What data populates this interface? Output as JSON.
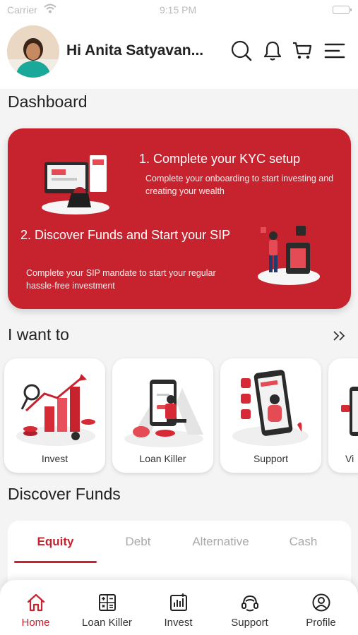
{
  "status_bar": {
    "carrier": "Carrier",
    "time": "9:15 PM"
  },
  "header": {
    "greeting": "Hi Anita Satyavan...",
    "icons": [
      "search-icon",
      "bell-icon",
      "cart-icon",
      "menu-icon"
    ]
  },
  "dashboard": {
    "title": "Dashboard",
    "kyc": {
      "title": "1. Complete your KYC setup",
      "description": "Complete your onboarding to start investing and creating your wealth"
    },
    "sip": {
      "title": "2. Discover Funds and Start your SIP",
      "description": "Complete your SIP mandate to start your regular hassle-free investment"
    }
  },
  "want_to": {
    "title": "I want to",
    "tiles": [
      {
        "label": "Invest"
      },
      {
        "label": "Loan Killer"
      },
      {
        "label": "Support"
      },
      {
        "label": "Vi"
      }
    ]
  },
  "discover_funds": {
    "title": "Discover Funds",
    "tabs": [
      "Equity",
      "Debt",
      "Alternative",
      "Cash"
    ],
    "active_tab": "Equity"
  },
  "bottom_nav": {
    "items": [
      {
        "label": "Home",
        "icon": "home-icon"
      },
      {
        "label": "Loan Killer",
        "icon": "calculator-icon"
      },
      {
        "label": "Invest",
        "icon": "chart-icon"
      },
      {
        "label": "Support",
        "icon": "headset-icon"
      },
      {
        "label": "Profile",
        "icon": "profile-icon"
      }
    ],
    "active": "Home"
  },
  "colors": {
    "brand_red": "#c7232f",
    "muted_tab": "#a9a9a9",
    "background": "#f4f4f4"
  }
}
